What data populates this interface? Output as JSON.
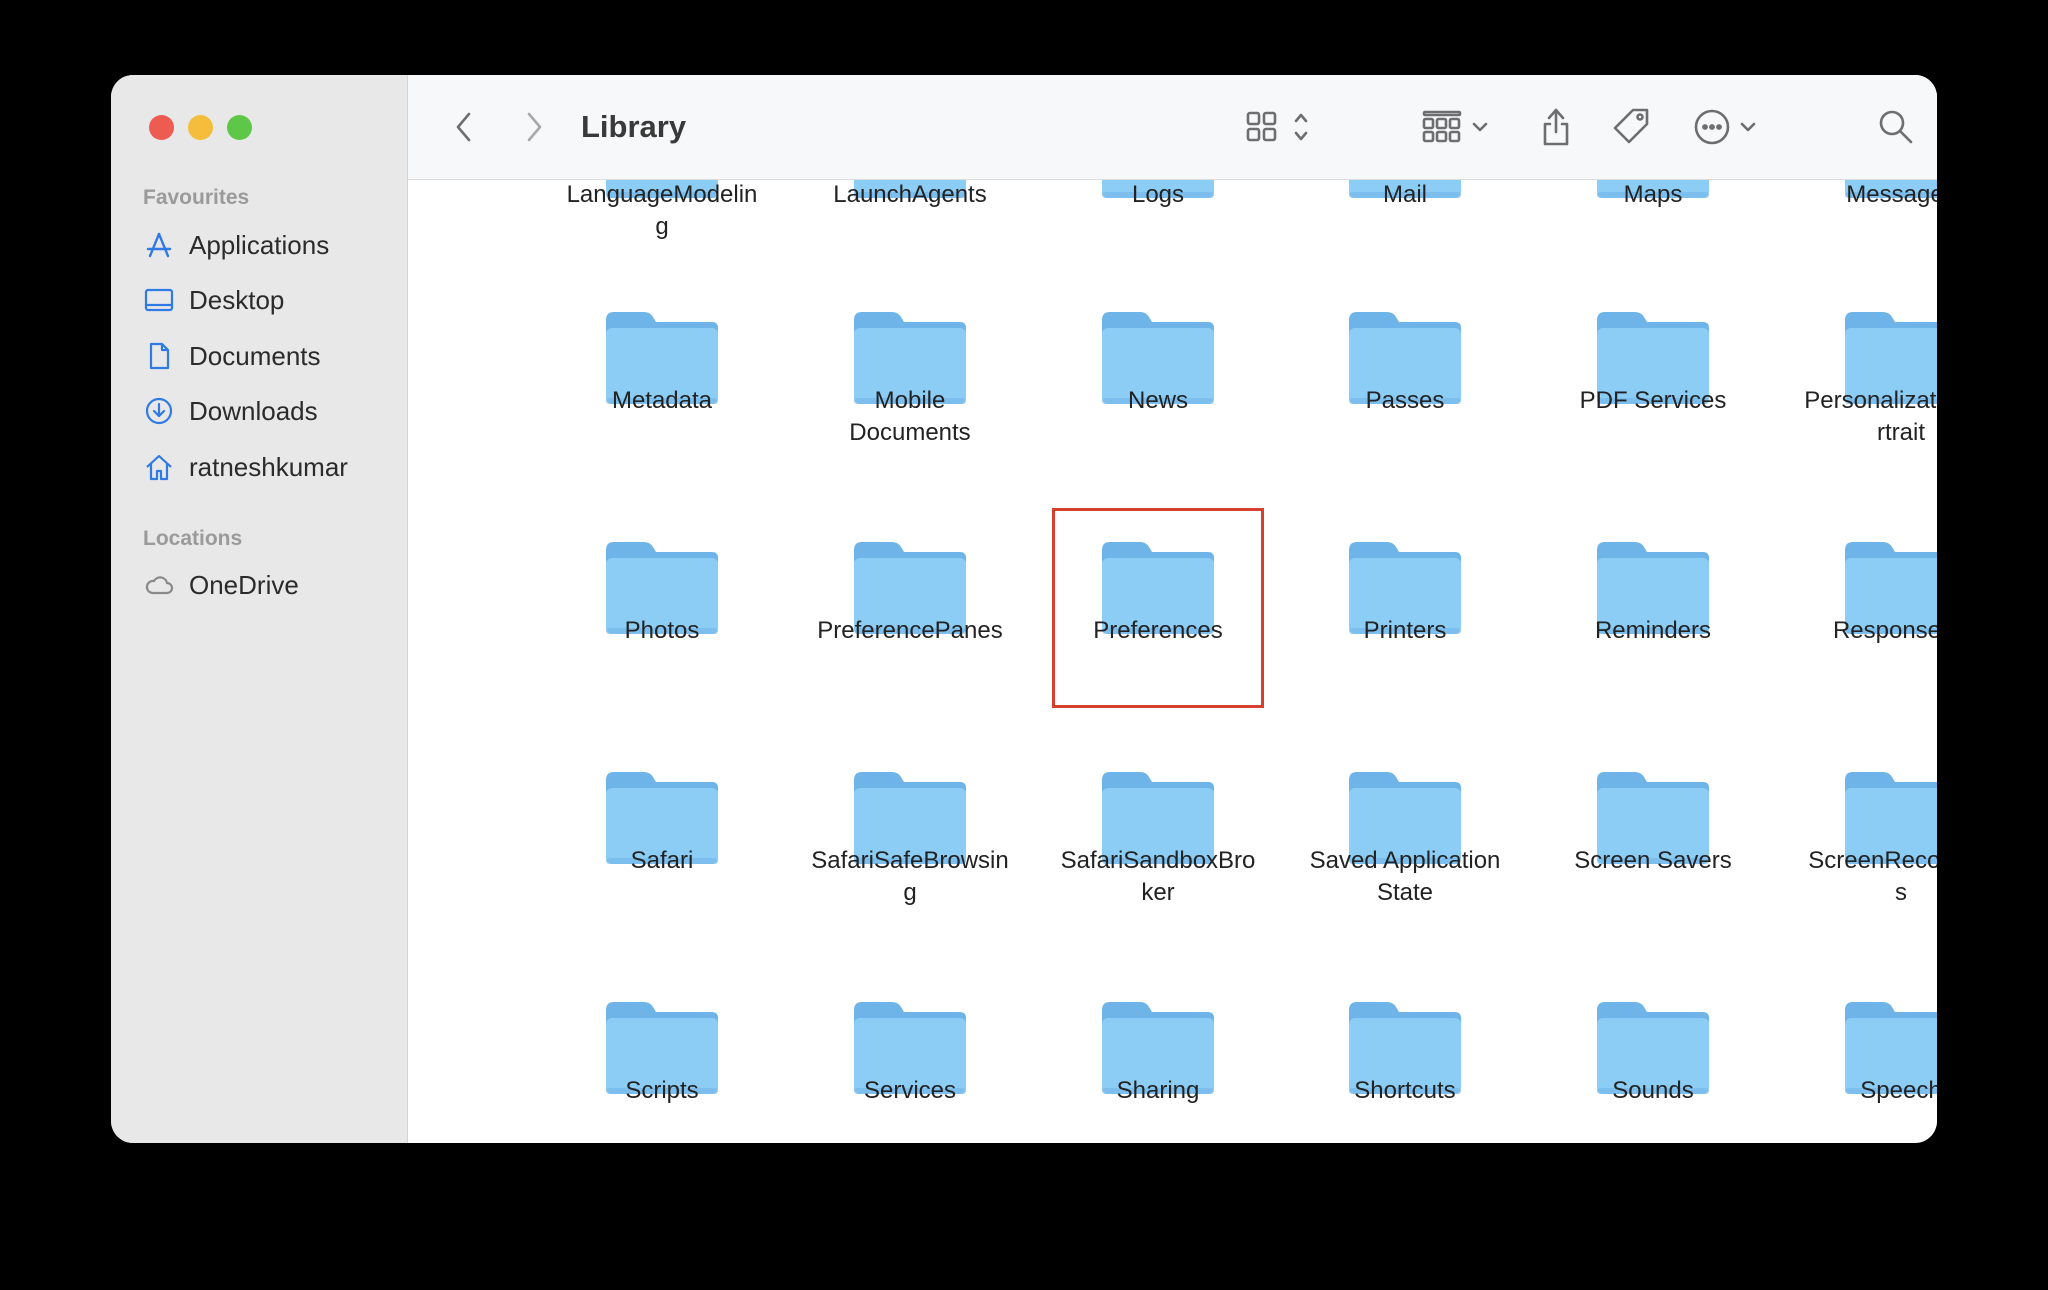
{
  "window": {
    "title": "Library"
  },
  "sidebar": {
    "favourites_heading": "Favourites",
    "favourites": [
      {
        "label": "Applications",
        "icon": "applications-icon"
      },
      {
        "label": "Desktop",
        "icon": "desktop-icon"
      },
      {
        "label": "Documents",
        "icon": "document-icon"
      },
      {
        "label": "Downloads",
        "icon": "downloads-icon"
      },
      {
        "label": "ratneshkumar",
        "icon": "home-icon"
      }
    ],
    "locations_heading": "Locations",
    "locations": [
      {
        "label": "OneDrive",
        "icon": "cloud-icon"
      }
    ]
  },
  "toolbar": {
    "back": "chevron-left-icon",
    "forward": "chevron-right-icon",
    "view": "grid-view-icon",
    "group": "group-by-icon",
    "share": "share-icon",
    "tag": "tag-icon",
    "more": "more-icon",
    "search": "search-icon"
  },
  "items": [
    {
      "row": [
        "LanguageModelin\ng",
        "LaunchAgents",
        "Logs",
        "Mail",
        "Maps",
        "Messages"
      ]
    },
    {
      "row": [
        "Metadata",
        "Mobile\nDocuments",
        "News",
        "Passes",
        "PDF Services",
        "PersonalizationPo\nrtrait"
      ]
    },
    {
      "row": [
        "Photos",
        "PreferencePanes",
        "Preferences",
        "Printers",
        "Reminders",
        "ResponseKit"
      ]
    },
    {
      "row": [
        "Safari",
        "SafariSafeBrowsin\ng",
        "SafariSandboxBro\nker",
        "Saved Application\nState",
        "Screen Savers",
        "ScreenRecording\ns"
      ]
    },
    {
      "row": [
        "Scripts",
        "Services",
        "Sharing",
        "Shortcuts",
        "Sounds",
        "Speech"
      ]
    }
  ],
  "highlighted_item": "Preferences",
  "colors": {
    "folder_body": "#8ccdf6",
    "folder_tab": "#6fb4e8",
    "highlight": "#d5412c"
  }
}
